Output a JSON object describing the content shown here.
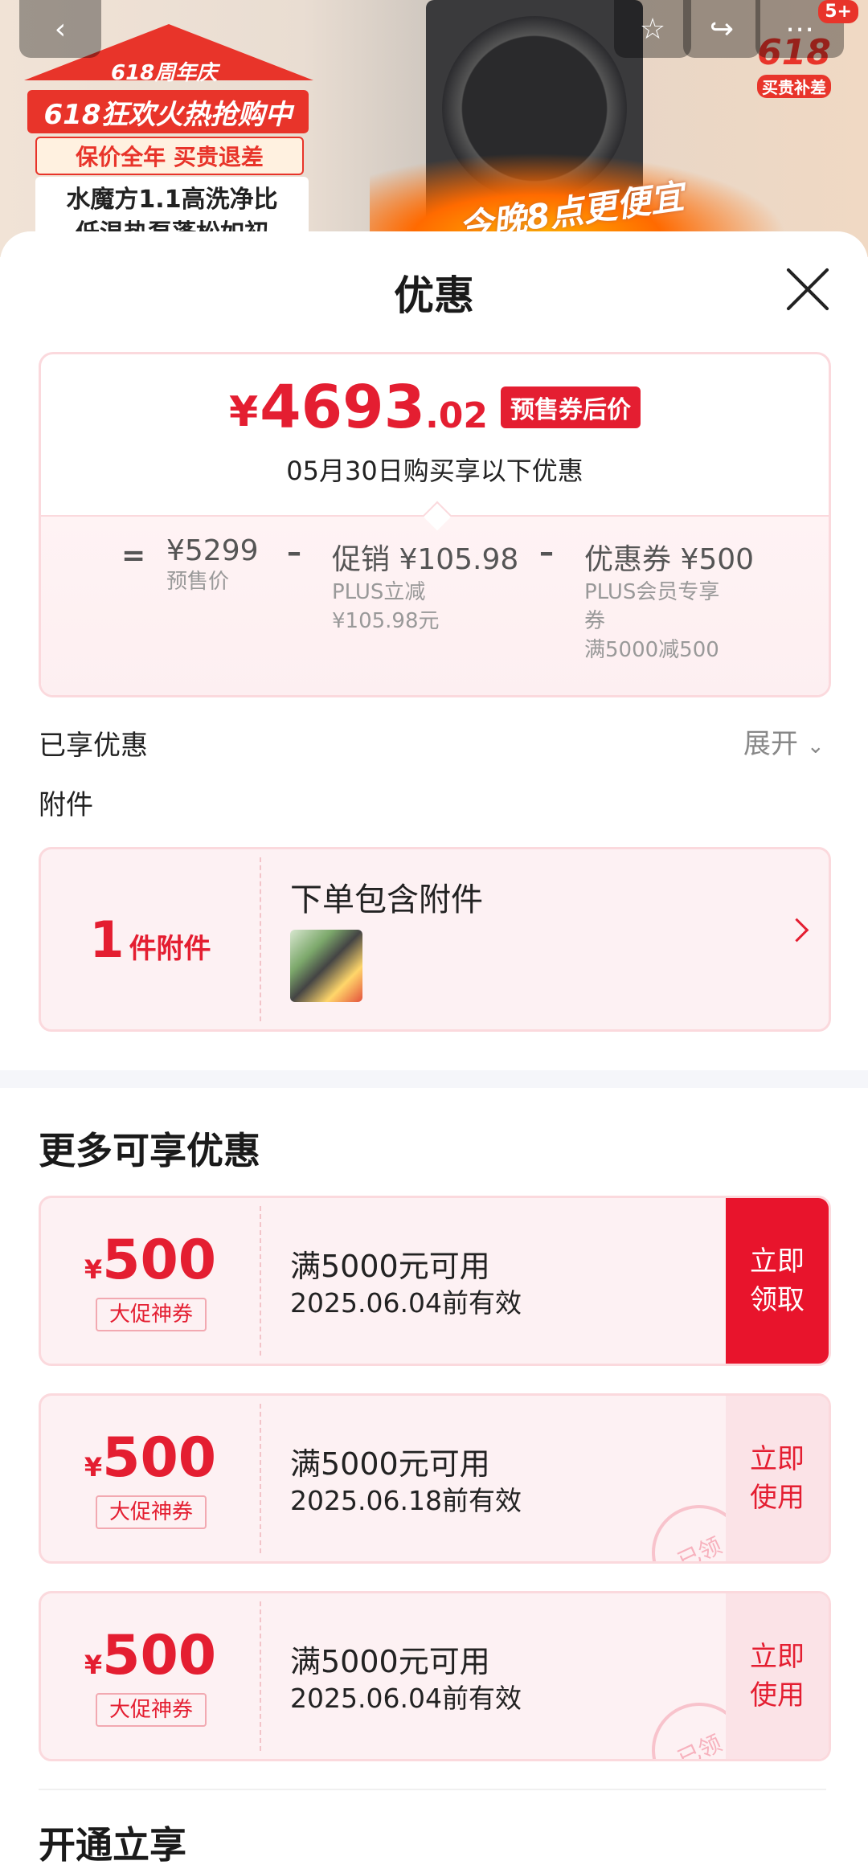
{
  "banner": {
    "anniv": "618周年庆",
    "headline": "618狂欢火热抢购中",
    "guarantee": "保价全年 买贵退差",
    "product_line1": "水魔方1.1高洗净比",
    "product_line2": "低温热泵蓬松如初",
    "slogan": "今晚8点更便宜",
    "badge_618": "618",
    "badge_sub": "买贵补差",
    "count_badge": "5+"
  },
  "sheet": {
    "title": "优惠"
  },
  "price": {
    "currency": "¥",
    "integer": "4693",
    "decimal": ".02",
    "tag": "预售券后价",
    "subtitle": "05月30日购买享以下优惠",
    "equals": "=",
    "base_value": "¥5299",
    "base_label": "预售价",
    "minus1": "–",
    "promo_value": "促销 ¥105.98",
    "promo_desc1": "PLUS立减",
    "promo_desc2": "¥105.98元",
    "minus2": "–",
    "coupon_value": "优惠券 ¥500",
    "coupon_desc1": "PLUS会员专享",
    "coupon_desc2": "券",
    "coupon_desc3": "满5000减500"
  },
  "enjoyed": {
    "label": "已享优惠",
    "expand": "展开"
  },
  "attachment": {
    "section_label": "附件",
    "count": "1",
    "count_unit": "件附件",
    "title": "下单包含附件"
  },
  "more": {
    "title": "更多可享优惠",
    "coupons": [
      {
        "currency": "¥",
        "amount": "500",
        "label": "大促神券",
        "condition": "满5000元可用",
        "valid": "2025.06.04前有效",
        "action": "立即领取",
        "stamp": ""
      },
      {
        "currency": "¥",
        "amount": "500",
        "label": "大促神券",
        "condition": "满5000元可用",
        "valid": "2025.06.18前有效",
        "action": "立即使用",
        "stamp": "已领"
      },
      {
        "currency": "¥",
        "amount": "500",
        "label": "大促神券",
        "condition": "满5000元可用",
        "valid": "2025.06.04前有效",
        "action": "立即使用",
        "stamp": "已领"
      }
    ],
    "next_section_peek": "开通立享"
  },
  "colors": {
    "accent": "#e41e31",
    "border": "#fbd9dd",
    "bg_soft": "#fdf1f3"
  }
}
